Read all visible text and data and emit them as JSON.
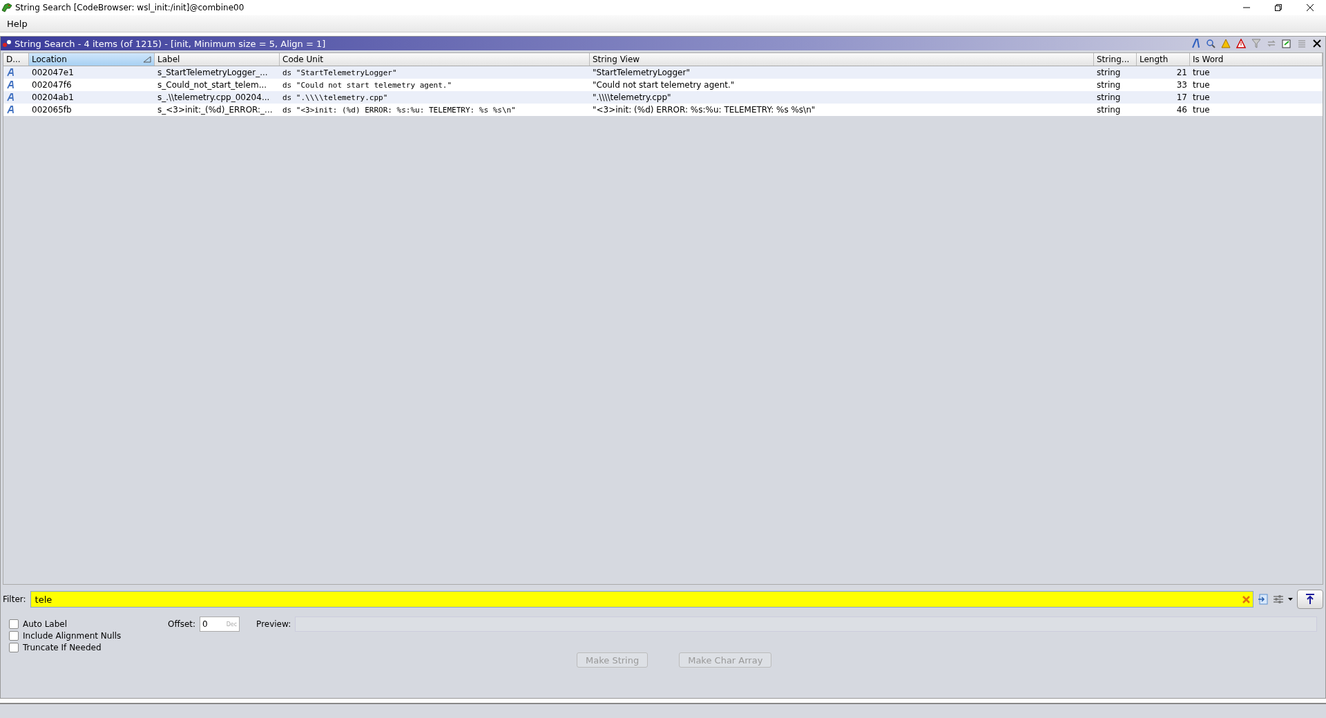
{
  "window": {
    "title": "String Search [CodeBrowser: wsl_init:/init]@combine00"
  },
  "menu": [
    "Help"
  ],
  "panel": {
    "title": "String Search - 4 items (of 1215) - [init, Minimum size = 5, Align = 1]"
  },
  "table": {
    "columns": [
      {
        "label": "D...",
        "sorted": false
      },
      {
        "label": "Location",
        "sorted": true
      },
      {
        "label": "Label",
        "sorted": false
      },
      {
        "label": "Code Unit",
        "sorted": false
      },
      {
        "label": "String View",
        "sorted": false
      },
      {
        "label": "String...",
        "sorted": false
      },
      {
        "label": "Length",
        "sorted": false
      },
      {
        "label": "Is Word",
        "sorted": false
      }
    ],
    "rows": [
      {
        "location": "002047e1",
        "label": "s_StartTelemetryLogger_...",
        "code_unit": "ds \"StartTelemetryLogger\"",
        "string_view": "\"StartTelemetryLogger\"",
        "type": "string",
        "length": "21",
        "is_word": "true"
      },
      {
        "location": "002047f6",
        "label": "s_Could_not_start_telem...",
        "code_unit": "ds \"Could not start telemetry agent.\"",
        "string_view": "\"Could not start telemetry agent.\"",
        "type": "string",
        "length": "33",
        "is_word": "true"
      },
      {
        "location": "00204ab1",
        "label": "s_.\\\\telemetry.cpp_00204...",
        "code_unit": "ds \".\\\\\\\\telemetry.cpp\"",
        "string_view": "\".\\\\\\\\telemetry.cpp\"",
        "type": "string",
        "length": "17",
        "is_word": "true"
      },
      {
        "location": "002065fb",
        "label": "s_<3>init:_(%d)_ERROR:_...",
        "code_unit": "ds \"<3>init: (%d) ERROR: %s:%u: TELEMETRY: %s %s\\n\"",
        "string_view": "\"<3>init: (%d) ERROR: %s:%u: TELEMETRY: %s %s\\n\"",
        "type": "string",
        "length": "46",
        "is_word": "true"
      }
    ]
  },
  "filter": {
    "label": "Filter:",
    "value": "tele"
  },
  "options": {
    "checkboxes": [
      {
        "label": "Auto Label",
        "checked": false
      },
      {
        "label": "Include Alignment Nulls",
        "checked": false
      },
      {
        "label": "Truncate If Needed",
        "checked": false
      }
    ],
    "offset": {
      "label": "Offset:",
      "value": "0",
      "unit": "Dec"
    },
    "preview": {
      "label": "Preview:"
    },
    "buttons": [
      {
        "label": "Make String",
        "disabled": true
      },
      {
        "label": "Make Char Array",
        "disabled": true
      }
    ]
  }
}
